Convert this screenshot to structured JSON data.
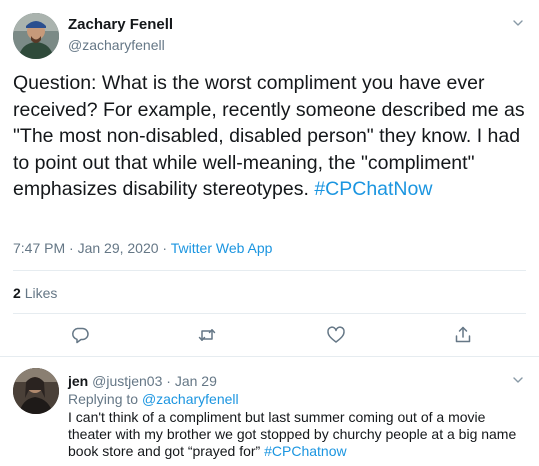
{
  "tweet": {
    "author_name": "Zachary Fenell",
    "author_handle": "@zacharyfenell",
    "text": "Question: What is the worst compliment you have ever received? For example, recently someone described me as \"The most non-disabled, disabled person\" they know. I had to point out that while well-meaning, the \"compliment\" emphasizes disability stereotypes. ",
    "hashtag": "#CPChatNow",
    "timestamp": "7:47 PM · Jan 29, 2020",
    "separator": " · ",
    "source": "Twitter Web App",
    "likes_count": "2",
    "likes_label": "Likes"
  },
  "actions": {
    "reply_icon": "comment-icon",
    "retweet_icon": "retweet-icon",
    "like_icon": "heart-icon",
    "share_icon": "share-icon"
  },
  "reply": {
    "author_name": "jen",
    "author_handle": "@justjen03",
    "separator": " · ",
    "date": "Jan 29",
    "replying_prefix": "Replying to ",
    "replying_to": "@zacharyfenell",
    "text": "I can't think of a compliment but last summer coming out of a movie theater with my brother we got stopped by churchy people at a big name book store and got “prayed for” ",
    "hashtag": "#CPChatnow"
  },
  "colors": {
    "accent": "#1b95e0",
    "secondary_text": "#657786",
    "divider": "#e6ecf0"
  }
}
